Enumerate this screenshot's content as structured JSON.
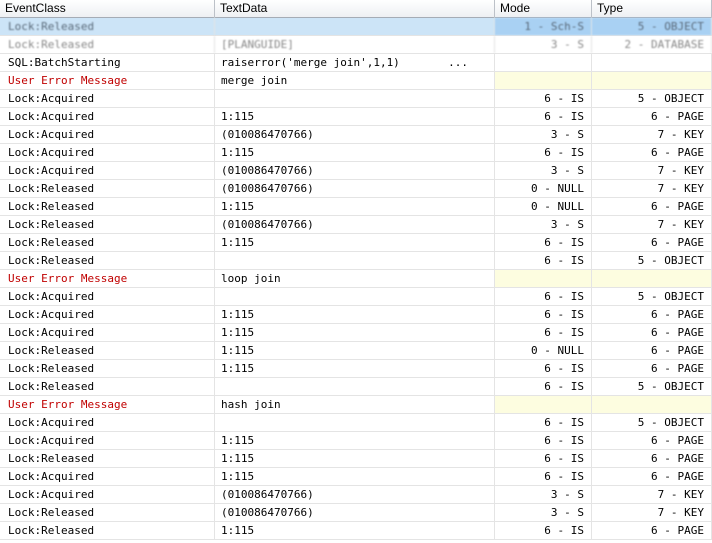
{
  "columns": {
    "event_class": "EventClass",
    "text_data": "TextData",
    "mode": "Mode",
    "type": "Type"
  },
  "rows": [
    {
      "event": "Lock:Released",
      "text": "",
      "mode": "1 - Sch-S",
      "type": "5 - OBJECT",
      "kind": "sel"
    },
    {
      "event": "Lock:Released",
      "text": "[PLANGUIDE]",
      "mode": "3 - S",
      "type": "2 - DATABASE",
      "kind": "blur"
    },
    {
      "event": "SQL:BatchStarting",
      "text": "raiserror('merge join',1,1)",
      "more": "...",
      "mode": "",
      "type": "",
      "kind": "batch"
    },
    {
      "event": "User Error Message",
      "text": "merge join",
      "mode": "",
      "type": "",
      "kind": "err"
    },
    {
      "event": "Lock:Acquired",
      "text": "",
      "mode": "6 - IS",
      "type": "5 - OBJECT",
      "kind": "normal"
    },
    {
      "event": "Lock:Acquired",
      "text": "1:115",
      "mode": "6 - IS",
      "type": "6 - PAGE",
      "kind": "normal"
    },
    {
      "event": "Lock:Acquired",
      "text": "(010086470766)",
      "mode": "3 - S",
      "type": "7 - KEY",
      "kind": "normal"
    },
    {
      "event": "Lock:Acquired",
      "text": "1:115",
      "mode": "6 - IS",
      "type": "6 - PAGE",
      "kind": "normal"
    },
    {
      "event": "Lock:Acquired",
      "text": "(010086470766)",
      "mode": "3 - S",
      "type": "7 - KEY",
      "kind": "normal"
    },
    {
      "event": "Lock:Released",
      "text": "(010086470766)",
      "mode": "0 - NULL",
      "type": "7 - KEY",
      "kind": "normal"
    },
    {
      "event": "Lock:Released",
      "text": "1:115",
      "mode": "0 - NULL",
      "type": "6 - PAGE",
      "kind": "normal"
    },
    {
      "event": "Lock:Released",
      "text": "(010086470766)",
      "mode": "3 - S",
      "type": "7 - KEY",
      "kind": "normal"
    },
    {
      "event": "Lock:Released",
      "text": "1:115",
      "mode": "6 - IS",
      "type": "6 - PAGE",
      "kind": "normal"
    },
    {
      "event": "Lock:Released",
      "text": "",
      "mode": "6 - IS",
      "type": "5 - OBJECT",
      "kind": "normal"
    },
    {
      "event": "User Error Message",
      "text": "loop join",
      "mode": "",
      "type": "",
      "kind": "err"
    },
    {
      "event": "Lock:Acquired",
      "text": "",
      "mode": "6 - IS",
      "type": "5 - OBJECT",
      "kind": "normal"
    },
    {
      "event": "Lock:Acquired",
      "text": "1:115",
      "mode": "6 - IS",
      "type": "6 - PAGE",
      "kind": "normal"
    },
    {
      "event": "Lock:Acquired",
      "text": "1:115",
      "mode": "6 - IS",
      "type": "6 - PAGE",
      "kind": "normal"
    },
    {
      "event": "Lock:Released",
      "text": "1:115",
      "mode": "0 - NULL",
      "type": "6 - PAGE",
      "kind": "normal"
    },
    {
      "event": "Lock:Released",
      "text": "1:115",
      "mode": "6 - IS",
      "type": "6 - PAGE",
      "kind": "normal"
    },
    {
      "event": "Lock:Released",
      "text": "",
      "mode": "6 - IS",
      "type": "5 - OBJECT",
      "kind": "normal"
    },
    {
      "event": "User Error Message",
      "text": "hash join",
      "mode": "",
      "type": "",
      "kind": "err"
    },
    {
      "event": "Lock:Acquired",
      "text": "",
      "mode": "6 - IS",
      "type": "5 - OBJECT",
      "kind": "normal"
    },
    {
      "event": "Lock:Acquired",
      "text": "1:115",
      "mode": "6 - IS",
      "type": "6 - PAGE",
      "kind": "normal"
    },
    {
      "event": "Lock:Released",
      "text": "1:115",
      "mode": "6 - IS",
      "type": "6 - PAGE",
      "kind": "normal"
    },
    {
      "event": "Lock:Acquired",
      "text": "1:115",
      "mode": "6 - IS",
      "type": "6 - PAGE",
      "kind": "normal"
    },
    {
      "event": "Lock:Acquired",
      "text": "(010086470766)",
      "mode": "3 - S",
      "type": "7 - KEY",
      "kind": "normal"
    },
    {
      "event": "Lock:Released",
      "text": "(010086470766)",
      "mode": "3 - S",
      "type": "7 - KEY",
      "kind": "normal"
    },
    {
      "event": "Lock:Released",
      "text": "1:115",
      "mode": "6 - IS",
      "type": "6 - PAGE",
      "kind": "normal"
    }
  ]
}
